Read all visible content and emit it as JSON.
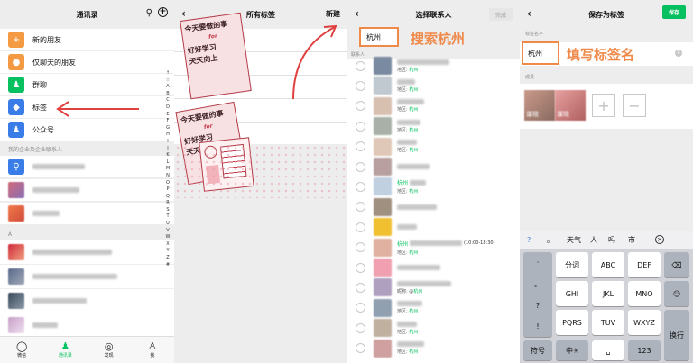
{
  "panel1": {
    "title": "通讯录",
    "menu": [
      {
        "label": "新的朋友",
        "icon": "person-add-icon",
        "color": "#f39a42"
      },
      {
        "label": "仅聊天的朋友",
        "icon": "person-chat-icon",
        "color": "#f39a42"
      },
      {
        "label": "群聊",
        "icon": "group-icon",
        "color": "#07c160"
      },
      {
        "label": "标签",
        "icon": "tag-icon",
        "color": "#3b7de8"
      },
      {
        "label": "公众号",
        "icon": "official-account-icon",
        "color": "#3b7de8"
      }
    ],
    "enterprise_header": "我的企业及企业联系人",
    "section_letter": "A",
    "index_letters": [
      "↑",
      "☆",
      "A",
      "B",
      "C",
      "D",
      "E",
      "F",
      "G",
      "H",
      "I",
      "J",
      "K",
      "L",
      "M",
      "N",
      "O",
      "P",
      "Q",
      "R",
      "S",
      "T",
      "U",
      "V",
      "W",
      "X",
      "Y",
      "Z",
      "#"
    ],
    "tabs": [
      {
        "label": "微信",
        "icon": "chat-icon"
      },
      {
        "label": "通讯录",
        "icon": "contacts-icon"
      },
      {
        "label": "发现",
        "icon": "discover-icon"
      },
      {
        "label": "我",
        "icon": "me-icon"
      }
    ],
    "badge": "···"
  },
  "panel2": {
    "title": "所有标签",
    "new_label": "新建",
    "sticker_lines": [
      "今天要做的事",
      "for",
      "好好学习",
      "天天向上",
      "今天要做的事",
      "for",
      "好好学习",
      "天天向上"
    ]
  },
  "panel3": {
    "title": "选择联系人",
    "done_label": "完成",
    "search_value": "杭州",
    "annotation": "搜索杭州",
    "section": "联系人",
    "contacts": [
      {
        "sub_prefix": "地区: ",
        "sub_hl": "杭州"
      },
      {
        "sub_prefix": "地区: ",
        "sub_hl": "杭州"
      },
      {
        "sub_prefix": "地区: ",
        "sub_hl": "杭州"
      },
      {
        "sub_prefix": "地区: ",
        "sub_hl": "杭州"
      },
      {
        "sub_prefix": "地区: ",
        "sub_hl": "杭州"
      },
      {
        "sub_prefix": "",
        "sub_hl": ""
      },
      {
        "sub_prefix": "地区: ",
        "sub_hl": "杭州"
      },
      {
        "sub_prefix": "",
        "sub_hl": ""
      },
      {
        "sub_prefix": "",
        "sub_hl": ""
      },
      {
        "sub_prefix": "地区: ",
        "sub_hl": "杭州"
      },
      {
        "sub_prefix": "",
        "sub_hl": ""
      },
      {
        "sub_prefix": "昵称: @",
        "sub_hl": "杭州"
      },
      {
        "sub_prefix": "地区: ",
        "sub_hl": "杭州"
      },
      {
        "sub_prefix": "地区: ",
        "sub_hl": "杭州"
      },
      {
        "sub_prefix": "地区: ",
        "sub_hl": "杭州"
      }
    ],
    "text_rows": {
      "6": "杭州",
      "9": "杭州"
    },
    "time_text": "(10:00-18:30)"
  },
  "panel4": {
    "title": "保存为标签",
    "save_label": "保存",
    "name_section": "标签名字",
    "name_value": "杭州",
    "annotation": "填写标签名",
    "members_section": "成员",
    "member_caption": "谋晓",
    "suggestions": [
      "?",
      "。",
      "天气",
      "人",
      "吗",
      "市"
    ],
    "keys_row1": [
      "分词",
      "ABC",
      "DEF"
    ],
    "keys_row2": [
      "GHI",
      "JKL",
      "MNO"
    ],
    "keys_row3": [
      "PQRS",
      "TUV",
      "WXYZ"
    ],
    "left_col": [
      "·",
      "。",
      "?",
      "!"
    ],
    "bottom": {
      "symbol": "符号",
      "lang": "中",
      "lang_sub": "英",
      "num": "123",
      "enter": "换行"
    }
  },
  "colors": {
    "accent_green": "#07c160",
    "annotation_orange": "#f08a4b",
    "arrow_red": "#e04040"
  }
}
